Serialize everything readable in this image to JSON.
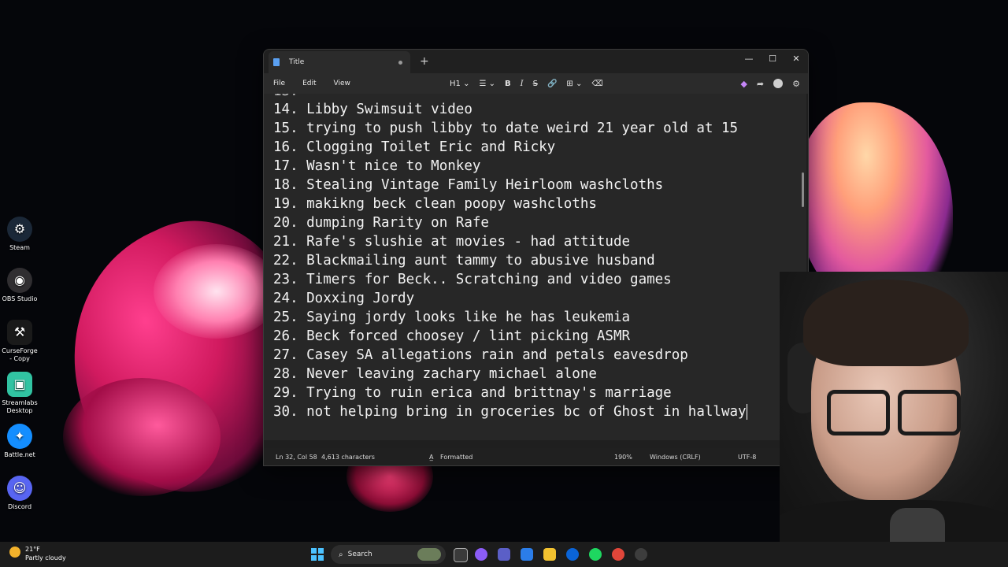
{
  "desktop_icons": [
    {
      "label": "Steam",
      "icon": "steam-icon",
      "color": "#1b2838"
    },
    {
      "label": "OBS Studio",
      "icon": "obs-icon",
      "color": "#302e31"
    },
    {
      "label": "CurseForge - Copy",
      "icon": "curseforge-icon",
      "color": "#1a1a1a"
    },
    {
      "label": "Streamlabs Desktop",
      "icon": "streamlabs-icon",
      "color": "#31c3a2"
    },
    {
      "label": "Battle.net",
      "icon": "battlenet-icon",
      "color": "#148eff"
    },
    {
      "label": "Discord",
      "icon": "discord-icon",
      "color": "#5865f2"
    }
  ],
  "window": {
    "tab_title": "Title",
    "new_tab": "+",
    "controls": {
      "minimize": "—",
      "maximize": "☐",
      "close": "✕"
    }
  },
  "menu": {
    "file": "File",
    "edit": "Edit",
    "view": "View"
  },
  "toolbar": {
    "heading": "H1",
    "bold": "B",
    "italic": "I",
    "strike": "S"
  },
  "lines": [
    "14. Libby Swimsuit video",
    "15. trying to push libby to date weird 21 year old at 15",
    "16. Clogging Toilet Eric and Ricky",
    "17. Wasn't nice to Monkey",
    "18. Stealing Vintage Family Heirloom washcloths",
    "19. makikng beck clean poopy washcloths",
    "20. dumping Rarity on Rafe",
    "21. Rafe's slushie at movies - had attitude",
    "22. Blackmailing aunt tammy to abusive husband",
    "23. Timers for Beck.. Scratching and video games",
    "24. Doxxing Jordy",
    "25. Saying jordy looks like he has leukemia",
    "26. Beck forced choosey / lint picking ASMR",
    "27. Casey SA allegations rain and petals eavesdrop",
    "28. Never leaving zachary michael alone",
    "29. Trying to ruin erica and brittnay's marriage",
    "30. not helping bring in groceries bc of Ghost in hallway"
  ],
  "status": {
    "position": "Ln 32, Col 58",
    "characters": "4,613 characters",
    "formatted": "Formatted",
    "zoom": "190%",
    "line_endings": "Windows (CRLF)",
    "encoding": "UTF-8"
  },
  "taskbar": {
    "temperature": "21°F",
    "weather": "Partly cloudy",
    "search_placeholder": "Search"
  }
}
